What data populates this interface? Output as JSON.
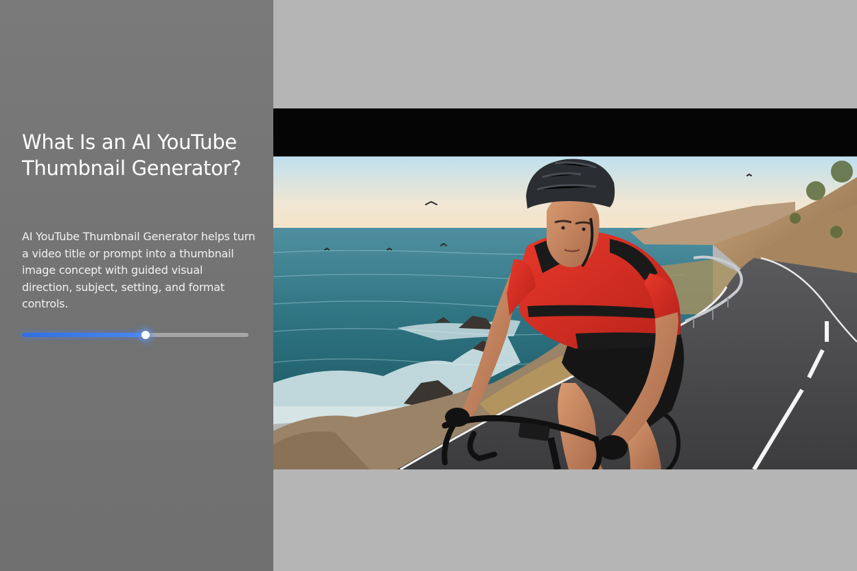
{
  "side_panel": {
    "title": "What Is an AI YouTube Thumbnail Generator?",
    "description": "AI YouTube Thumbnail Generator helps turn a video title or prompt into a thumbnail image concept with guided visual direction, subject, setting, and format controls.",
    "progress": 0.545
  },
  "preview": {
    "image_icon": "cyclist-coastal-road-image"
  },
  "colors": {
    "panel_bg": "#777777",
    "preview_bg": "#b5b5b5",
    "letterbox": "#050505",
    "accent": "#3a7be8"
  }
}
